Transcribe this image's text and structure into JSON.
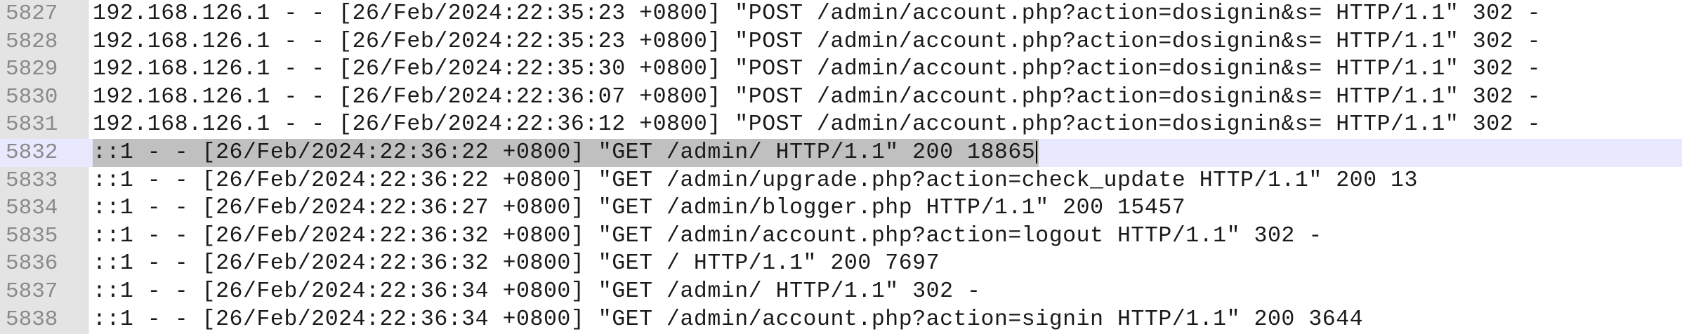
{
  "editor": {
    "current_line": "5832",
    "lines": [
      {
        "num": "5827",
        "text": "192.168.126.1 - - [26/Feb/2024:22:35:23 +0800] \"POST /admin/account.php?action=dosignin&s= HTTP/1.1\" 302 -"
      },
      {
        "num": "5828",
        "text": "192.168.126.1 - - [26/Feb/2024:22:35:23 +0800] \"POST /admin/account.php?action=dosignin&s= HTTP/1.1\" 302 -"
      },
      {
        "num": "5829",
        "text": "192.168.126.1 - - [26/Feb/2024:22:35:30 +0800] \"POST /admin/account.php?action=dosignin&s= HTTP/1.1\" 302 -"
      },
      {
        "num": "5830",
        "text": "192.168.126.1 - - [26/Feb/2024:22:36:07 +0800] \"POST /admin/account.php?action=dosignin&s= HTTP/1.1\" 302 -"
      },
      {
        "num": "5831",
        "text": "192.168.126.1 - - [26/Feb/2024:22:36:12 +0800] \"POST /admin/account.php?action=dosignin&s= HTTP/1.1\" 302 -"
      },
      {
        "num": "5832",
        "text": "::1 - - [26/Feb/2024:22:36:22 +0800] \"GET /admin/ HTTP/1.1\" 200 18865"
      },
      {
        "num": "5833",
        "text": "::1 - - [26/Feb/2024:22:36:22 +0800] \"GET /admin/upgrade.php?action=check_update HTTP/1.1\" 200 13"
      },
      {
        "num": "5834",
        "text": "::1 - - [26/Feb/2024:22:36:27 +0800] \"GET /admin/blogger.php HTTP/1.1\" 200 15457"
      },
      {
        "num": "5835",
        "text": "::1 - - [26/Feb/2024:22:36:32 +0800] \"GET /admin/account.php?action=logout HTTP/1.1\" 302 -"
      },
      {
        "num": "5836",
        "text": "::1 - - [26/Feb/2024:22:36:32 +0800] \"GET / HTTP/1.1\" 200 7697"
      },
      {
        "num": "5837",
        "text": "::1 - - [26/Feb/2024:22:36:34 +0800] \"GET /admin/ HTTP/1.1\" 302 -"
      },
      {
        "num": "5838",
        "text": "::1 - - [26/Feb/2024:22:36:34 +0800] \"GET /admin/account.php?action=signin HTTP/1.1\" 200 3644"
      }
    ]
  },
  "colors": {
    "gutter_bg": "#e4e4e4",
    "current_line_bg": "#e8e8ff",
    "selection_bg": "#c0c0c0",
    "line_number": "#8a8a8a",
    "text": "#1a1a1a"
  }
}
